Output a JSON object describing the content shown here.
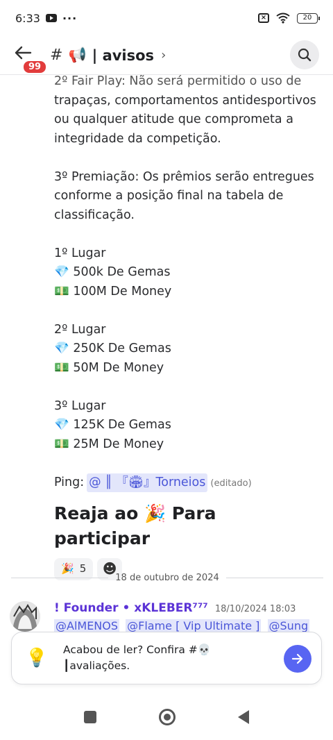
{
  "status_bar": {
    "time": "6:33",
    "dots": "···",
    "battery": "20"
  },
  "header": {
    "badge": "99",
    "hash": "#",
    "emoji": "📢",
    "channel": "| avisos",
    "chevron": "›"
  },
  "message": {
    "cut_line": "2º Fair Play: Não será permitido o uso de",
    "fairplay": [
      "trapaças, comportamentos antidesportivos",
      "ou qualquer atitude que comprometa a",
      "integridade da competição."
    ],
    "premiacao": [
      "3º Premiação: Os prêmios serão entregues",
      "conforme a posição final na tabela de",
      "classificação."
    ],
    "places": [
      {
        "title": "1º Lugar",
        "gems": "💎 500k De Gemas",
        "money": "💵 100M De Money"
      },
      {
        "title": "2º Lugar",
        "gems": "💎 250K De Gemas",
        "money": "💵 50M De Money"
      },
      {
        "title": "3º Lugar",
        "gems": "💎 125K De Gemas",
        "money": "💵 25M De Money"
      }
    ],
    "ping_label": "Ping:",
    "ping_mention": "@ ║ 『🏟』Torneios",
    "edited": "(editado)",
    "big_line": "Reaja ao 🎉 Para participar",
    "reaction_emoji": "🎉",
    "reaction_count": "5",
    "add_reaction": "☻"
  },
  "date_divider": "18 de outubro de 2024",
  "message2": {
    "author": "! Founder • xKLEBER⁷⁷⁷",
    "timestamp": "18/10/2024 18:03",
    "mentions": [
      "@AlMENOS",
      "@Flame [ Vip Ultimate ]",
      "@Sung"
    ]
  },
  "suggestion_card": {
    "bulb": "💡",
    "line1": "Acabou de ler? Confira #💀",
    "line2": "┃avaliações."
  }
}
